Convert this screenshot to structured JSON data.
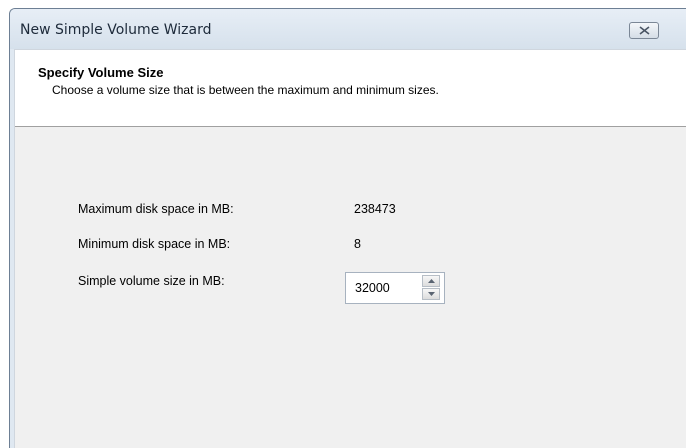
{
  "window": {
    "title": "New Simple Volume Wizard",
    "close_icon": "close-icon"
  },
  "header": {
    "title": "Specify Volume Size",
    "subtitle": "Choose a volume size that is between the maximum and minimum sizes."
  },
  "form": {
    "max_label": "Maximum disk space in MB:",
    "max_value": "238473",
    "min_label": "Minimum disk space in MB:",
    "min_value": "8",
    "size_label": "Simple volume size in MB:",
    "size_value": "32000",
    "spin_up_icon": "chevron-up-icon",
    "spin_down_icon": "chevron-down-icon"
  },
  "colors": {
    "titlebar": "#dfe8f1",
    "client": "#f0f0f0",
    "header": "#ffffff"
  }
}
